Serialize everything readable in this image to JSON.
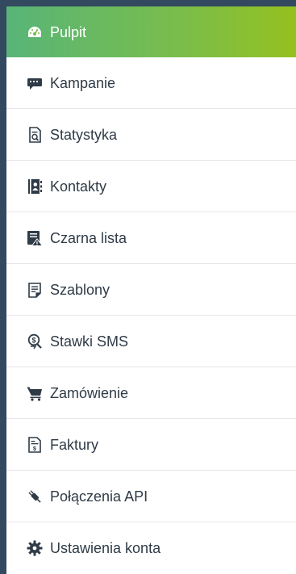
{
  "menu": {
    "items": [
      {
        "label": "Pulpit",
        "icon": "dashboard-icon",
        "active": true
      },
      {
        "label": "Kampanie",
        "icon": "chat-bubble-icon"
      },
      {
        "label": "Statystyka",
        "icon": "report-icon"
      },
      {
        "label": "Kontakty",
        "icon": "address-book-icon"
      },
      {
        "label": "Czarna lista",
        "icon": "blacklist-icon"
      },
      {
        "label": "Szablony",
        "icon": "template-icon"
      },
      {
        "label": "Stawki SMS",
        "icon": "price-tag-icon"
      },
      {
        "label": "Zamówienie",
        "icon": "cart-icon"
      },
      {
        "label": "Faktury",
        "icon": "invoice-icon"
      },
      {
        "label": "Połączenia API",
        "icon": "plug-icon"
      },
      {
        "label": "Ustawienia konta",
        "icon": "gear-icon"
      }
    ]
  },
  "colors": {
    "background": "#33495f",
    "active_gradient_start": "#57b578",
    "active_gradient_end": "#95c11f",
    "text": "#2f3b47",
    "divider": "#e4e7ea"
  }
}
